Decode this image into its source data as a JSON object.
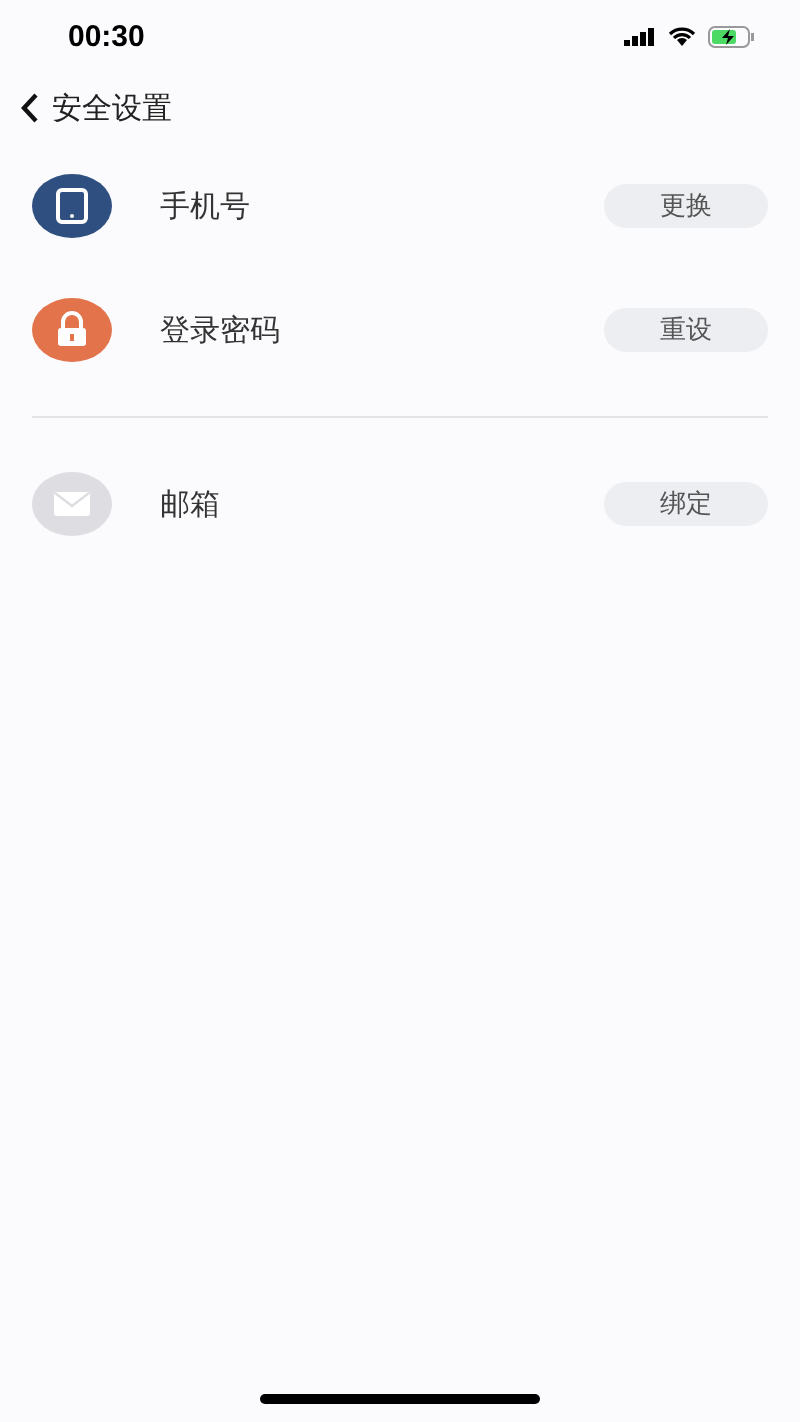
{
  "status_bar": {
    "time": "00:30"
  },
  "nav": {
    "title": "安全设置"
  },
  "sections": [
    {
      "items": [
        {
          "kind": "phone",
          "color": "#2e4f7f",
          "label": "手机号",
          "action": "更换"
        },
        {
          "kind": "lock",
          "color": "#e2734a",
          "label": "登录密码",
          "action": "重设"
        }
      ]
    },
    {
      "items": [
        {
          "kind": "mail",
          "color": "#dddde2",
          "label": "邮箱",
          "action": "绑定"
        }
      ]
    }
  ]
}
